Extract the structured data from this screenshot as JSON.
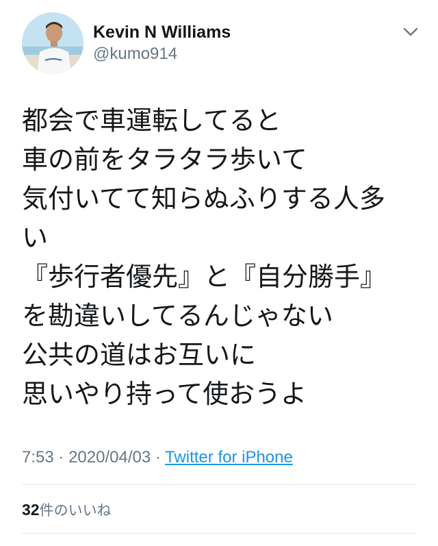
{
  "author": {
    "display_name": "Kevin N Williams",
    "handle": "@kumo914",
    "avatar_icon": "profile-photo",
    "menu_icon": "chevron-down-icon"
  },
  "tweet": {
    "lines": [
      "都会で車運転してると",
      "車の前をタラタラ歩いて",
      "気付いてて知らぬふりする人多",
      "い",
      "『歩行者優先』と『自分勝手』",
      "を勘違いしてるんじゃない",
      "公共の道はお互いに",
      "思いやり持って使おうよ"
    ]
  },
  "meta": {
    "time": "7:53",
    "separator": "·",
    "date": "2020/04/03",
    "source": "Twitter for iPhone"
  },
  "stats": {
    "likes_count": "32",
    "likes_label": "件のいいね"
  },
  "colors": {
    "text": "#14171a",
    "secondary": "#657786",
    "link": "#1b95e0",
    "divider": "#e1e8ed"
  }
}
